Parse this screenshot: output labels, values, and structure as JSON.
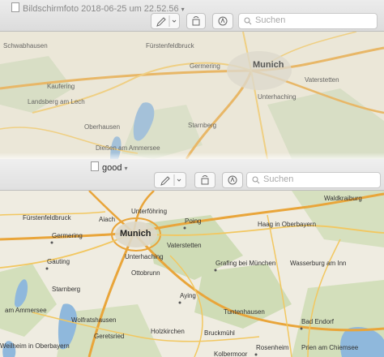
{
  "window_back": {
    "title": "Bildschirmfoto 2018-06-25 um 22.52.56",
    "search_placeholder": "Suchen",
    "map_labels": {
      "schwabhausen": "Schwabhausen",
      "fuerstenfeldbruck": "Fürstenfeldbruck",
      "germering": "Germering",
      "munich": "Munich",
      "vaterstetten": "Vaterstetten",
      "kaufering": "Kaufering",
      "landsberg": "Landsberg am Lech",
      "unterhaching": "Unterhaching",
      "oberhausen": "Oberhausen",
      "starnberg": "Starnberg",
      "diessen": "Dießen am Ammersee"
    }
  },
  "window_front": {
    "title": "good",
    "search_placeholder": "Suchen",
    "map_labels": {
      "unterfoehring": "Unterföhring",
      "waldkraiburg": "Waldkraiburg",
      "fuerstenfeldbruck": "Fürstenfeldbruck",
      "aiach": "Aiach",
      "poing": "Poing",
      "haag": "Haag in Oberbayern",
      "germering": "Germering",
      "munich": "Munich",
      "vaterstetten": "Vaterstetten",
      "gauting": "Gauting",
      "unterhaching": "Unterhaching",
      "grafing": "Grafing bei München",
      "wasserburg": "Wasserburg am Inn",
      "ottobrunn": "Ottobrunn",
      "starnberg": "Starnberg",
      "ammersee": "am Ammersee",
      "aying": "Aying",
      "tuntenhausen": "Tuntenhausen",
      "wolfratshausen": "Wolfratshausen",
      "bad_endorf": "Bad Endorf",
      "geretsried": "Geretsried",
      "holzkirchen": "Holzkirchen",
      "bruckmuehl": "Bruckmühl",
      "weilheim": "Weilheim in Oberbayern",
      "rosenheim": "Rosenheim",
      "prien": "Prien am Chiemsee",
      "kolbermoor": "Kolbermoor"
    }
  }
}
